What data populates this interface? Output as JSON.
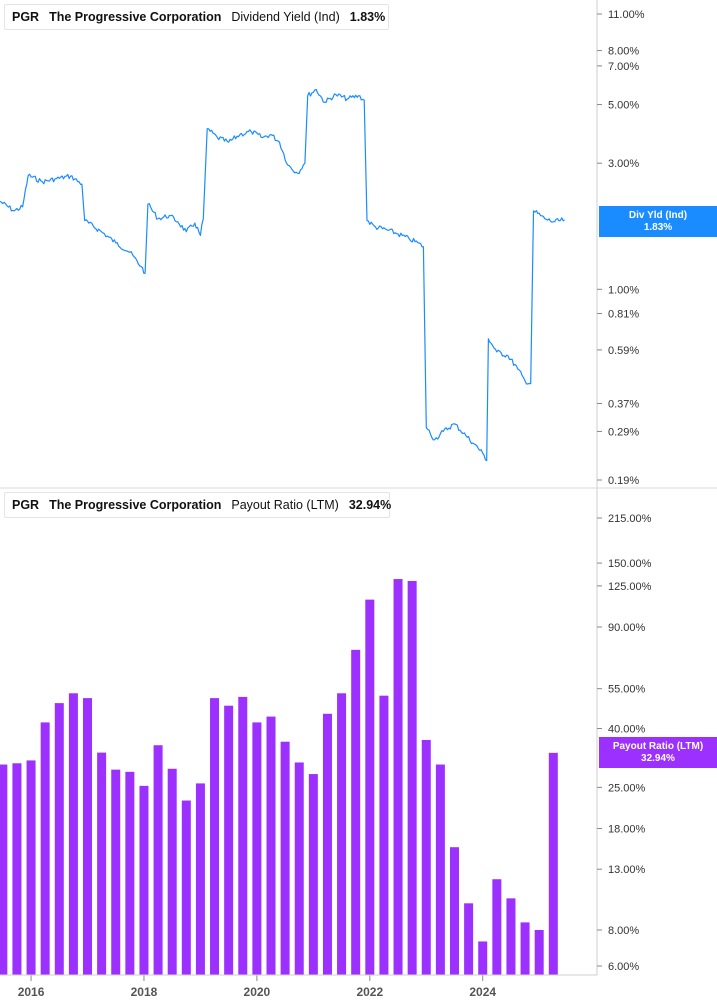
{
  "chart_data": [
    {
      "type": "line",
      "title": "",
      "ticker": "PGR",
      "company": "The Progressive Corporation",
      "metric": "Dividend Yield (Ind)",
      "last_value": "1.83%",
      "tag_label": "Div Yld (Ind)",
      "tag_value": "1.83%",
      "color": "#1a8cff",
      "y_scale": "log",
      "ylim": [
        0.17,
        13.5
      ],
      "y_ticks": [
        "11.00%",
        "8.00%",
        "7.00%",
        "5.00%",
        "3.00%",
        "1.00%",
        "0.81%",
        "0.59%",
        "0.37%",
        "0.29%",
        "0.19%"
      ],
      "y_tick_values": [
        11,
        8,
        7,
        5,
        3,
        1,
        0.81,
        0.59,
        0.37,
        0.29,
        0.19
      ],
      "x_range": [
        2015.45,
        2025.9
      ],
      "points": [
        [
          2015.45,
          2.15
        ],
        [
          2015.7,
          1.98
        ],
        [
          2015.85,
          2.05
        ],
        [
          2015.95,
          2.7
        ],
        [
          2016.2,
          2.55
        ],
        [
          2016.45,
          2.62
        ],
        [
          2016.7,
          2.68
        ],
        [
          2016.9,
          2.5
        ],
        [
          2016.95,
          1.82
        ],
        [
          2017.25,
          1.65
        ],
        [
          2017.5,
          1.5
        ],
        [
          2017.75,
          1.38
        ],
        [
          2017.95,
          1.22
        ],
        [
          2018.02,
          1.15
        ],
        [
          2018.07,
          2.1
        ],
        [
          2018.25,
          1.85
        ],
        [
          2018.45,
          1.9
        ],
        [
          2018.6,
          1.8
        ],
        [
          2018.75,
          1.65
        ],
        [
          2018.9,
          1.78
        ],
        [
          2019.0,
          1.6
        ],
        [
          2019.05,
          1.85
        ],
        [
          2019.12,
          4.05
        ],
        [
          2019.3,
          3.75
        ],
        [
          2019.5,
          3.6
        ],
        [
          2019.7,
          3.85
        ],
        [
          2019.9,
          3.95
        ],
        [
          2020.1,
          3.75
        ],
        [
          2020.25,
          3.85
        ],
        [
          2020.4,
          3.6
        ],
        [
          2020.55,
          2.95
        ],
        [
          2020.72,
          2.75
        ],
        [
          2020.85,
          3.0
        ],
        [
          2020.9,
          5.4
        ],
        [
          2021.05,
          5.7
        ],
        [
          2021.2,
          5.1
        ],
        [
          2021.4,
          5.45
        ],
        [
          2021.6,
          5.25
        ],
        [
          2021.8,
          5.4
        ],
        [
          2021.9,
          5.2
        ],
        [
          2021.95,
          1.82
        ],
        [
          2022.1,
          1.72
        ],
        [
          2022.3,
          1.68
        ],
        [
          2022.5,
          1.62
        ],
        [
          2022.7,
          1.55
        ],
        [
          2022.85,
          1.5
        ],
        [
          2022.95,
          1.45
        ],
        [
          2023.0,
          0.3
        ],
        [
          2023.15,
          0.27
        ],
        [
          2023.3,
          0.29
        ],
        [
          2023.5,
          0.31
        ],
        [
          2023.7,
          0.28
        ],
        [
          2023.85,
          0.26
        ],
        [
          2024.0,
          0.24
        ],
        [
          2024.07,
          0.225
        ],
        [
          2024.1,
          0.65
        ],
        [
          2024.25,
          0.58
        ],
        [
          2024.45,
          0.56
        ],
        [
          2024.62,
          0.5
        ],
        [
          2024.75,
          0.45
        ],
        [
          2024.85,
          0.44
        ],
        [
          2024.9,
          1.98
        ],
        [
          2025.1,
          1.85
        ],
        [
          2025.25,
          1.8
        ],
        [
          2025.45,
          1.83
        ]
      ]
    },
    {
      "type": "bar",
      "title": "",
      "ticker": "PGR",
      "company": "The Progressive Corporation",
      "metric": "Payout Ratio (LTM)",
      "last_value": "32.94%",
      "tag_label": "Payout Ratio (LTM)",
      "tag_value": "32.94%",
      "color": "#9b30ff",
      "y_scale": "log",
      "ylim": [
        5.6,
        265
      ],
      "y_ticks": [
        "215.00%",
        "150.00%",
        "125.00%",
        "90.00%",
        "55.00%",
        "40.00%",
        "25.00%",
        "18.00%",
        "13.00%",
        "8.00%",
        "6.00%"
      ],
      "y_tick_values": [
        215,
        150,
        125,
        90,
        55,
        40,
        25,
        18,
        13,
        8,
        6
      ],
      "x_ticks": [
        "2016",
        "2018",
        "2020",
        "2022",
        "2024"
      ],
      "x_tick_values": [
        2016,
        2018,
        2020,
        2022,
        2024
      ],
      "x_range": [
        2015.45,
        2025.9
      ],
      "bars": [
        [
          2015.5,
          30.0
        ],
        [
          2015.75,
          30.3
        ],
        [
          2016.0,
          31.0
        ],
        [
          2016.25,
          42.0
        ],
        [
          2016.5,
          49.0
        ],
        [
          2016.75,
          53.0
        ],
        [
          2017.0,
          51.0
        ],
        [
          2017.25,
          33.0
        ],
        [
          2017.5,
          28.8
        ],
        [
          2017.75,
          28.3
        ],
        [
          2018.0,
          25.3
        ],
        [
          2018.25,
          35.0
        ],
        [
          2018.5,
          29.0
        ],
        [
          2018.75,
          22.5
        ],
        [
          2019.0,
          25.8
        ],
        [
          2019.25,
          51.0
        ],
        [
          2019.5,
          48.0
        ],
        [
          2019.75,
          51.5
        ],
        [
          2020.0,
          42.0
        ],
        [
          2020.25,
          44.0
        ],
        [
          2020.5,
          36.0
        ],
        [
          2020.75,
          30.5
        ],
        [
          2021.0,
          27.8
        ],
        [
          2021.25,
          45.0
        ],
        [
          2021.5,
          53.0
        ],
        [
          2021.75,
          75.0
        ],
        [
          2022.0,
          112.0
        ],
        [
          2022.25,
          52.0
        ],
        [
          2022.5,
          132.0
        ],
        [
          2022.75,
          130.0
        ],
        [
          2023.0,
          36.5
        ],
        [
          2023.25,
          30.0
        ],
        [
          2023.5,
          15.5
        ],
        [
          2023.75,
          9.9
        ],
        [
          2024.0,
          7.3
        ],
        [
          2024.25,
          12.0
        ],
        [
          2024.5,
          10.3
        ],
        [
          2024.75,
          8.5
        ],
        [
          2025.0,
          8.0
        ],
        [
          2025.25,
          32.94
        ]
      ]
    }
  ]
}
